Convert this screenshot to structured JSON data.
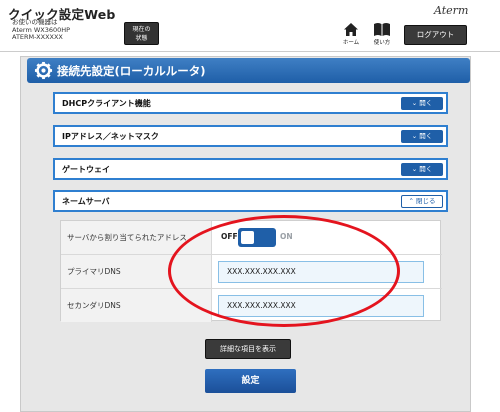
{
  "header": {
    "app_title": "クイック設定Web",
    "device_info": [
      "お使いの機器は",
      "Aterm WX3600HP",
      "ATERM-XXXXXX"
    ],
    "status_button": [
      "現在の",
      "状態"
    ],
    "brand": "Aterm",
    "home_label": "ホーム",
    "usage_label": "使い方",
    "logout_label": "ログアウト"
  },
  "section": {
    "title": "接続先設定(ローカルルータ)"
  },
  "accordions": [
    {
      "label": "DHCPクライアント機能",
      "button": "開く",
      "state": "closed"
    },
    {
      "label": "IPアドレス／ネットマスク",
      "button": "開く",
      "state": "closed"
    },
    {
      "label": "ゲートウェイ",
      "button": "開く",
      "state": "closed"
    },
    {
      "label": "ネームサーバ",
      "button": "閉じる",
      "state": "open"
    }
  ],
  "nameserver": {
    "auto_label": "サーバから割り当てられたアドレス",
    "toggle_off": "OFF",
    "toggle_on": "ON",
    "primary_label": "プライマリDNS",
    "primary_value": "XXX.XXX.XXX.XXX",
    "secondary_label": "セカンダリDNS",
    "secondary_value": "XXX.XXX.XXX.XXX"
  },
  "footer": {
    "detail_button": "詳細な項目を表示",
    "submit_button": "設定"
  },
  "colors": {
    "accent": "#1f5fa8",
    "highlight": "#e4141e"
  }
}
